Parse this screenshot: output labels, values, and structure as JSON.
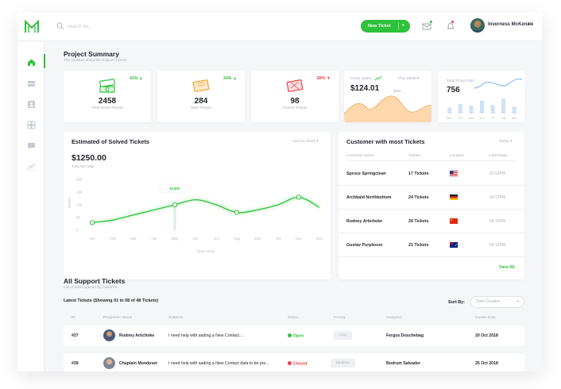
{
  "header": {
    "search_placeholder": "Search for...",
    "new_ticket_label": "New Ticket",
    "user_name": "Inverness McKenzie"
  },
  "colors": {
    "accent": "#2ec13a",
    "up": "#2ec13a",
    "down": "#f2424b",
    "orange": "#f0a436"
  },
  "sidebar": {
    "items": [
      {
        "icon": "home-icon",
        "active": true
      },
      {
        "icon": "ticket-stack-icon",
        "active": false
      },
      {
        "icon": "contact-card-icon",
        "active": false
      },
      {
        "icon": "grid-icon",
        "active": false
      },
      {
        "icon": "chat-icon",
        "active": false
      },
      {
        "icon": "stats-icon",
        "active": false
      }
    ]
  },
  "summary": {
    "title": "Project Summary",
    "subtitle": "The Updates about the Support Tickets",
    "stats": [
      {
        "pct": "41% ▲",
        "value": "2458",
        "label": "Total Novel Tickets",
        "icon": "ticket-stack-icon"
      },
      {
        "pct": "34% ▲",
        "value": "284",
        "label": "New Tickets",
        "icon": "ticket-icon"
      },
      {
        "pct": "68% ▼",
        "value": "98",
        "label": "Closed Tickets",
        "icon": "closed-ticket-icon"
      }
    ],
    "gross_sales": {
      "label": "Gross Sales",
      "value": "$124.01",
      "period": "This Week ▾",
      "peak_label": "$254"
    },
    "total_sold": {
      "label": "Total Ticket Sold",
      "value": "756",
      "days": [
        "Mon",
        "Tue",
        "Wed",
        "Thu",
        "Fri",
        "Sat",
        "Sun"
      ]
    }
  },
  "solved": {
    "title": "Estimated of Solved Tickets",
    "period": "Last 01 Years ▾",
    "amount": "$1250.00",
    "amount_label": "Total Net Sale",
    "tooltip": "$1000",
    "y_label": "Prices",
    "x_caption": "2018 Years"
  },
  "chart_data": {
    "type": "line",
    "title": "Estimated of Solved Tickets",
    "xlabel": "2018 Years",
    "ylabel": "Prices",
    "categories": [
      "Jan",
      "Feb",
      "Mar",
      "Apr",
      "May",
      "Jun",
      "Jul",
      "Aug",
      "Sep",
      "Oct",
      "Nov",
      "Dec"
    ],
    "values": [
      3,
      4,
      6,
      8,
      10,
      12,
      10,
      7,
      8,
      10,
      13,
      9
    ],
    "y_ticks": [
      "20k",
      "15k",
      "10k",
      "5k",
      "0"
    ],
    "ylim": [
      0,
      20
    ],
    "highlight_index": 4,
    "marked_indices": [
      0,
      4,
      7,
      10
    ]
  },
  "customers": {
    "title": "Customer with most Tickets",
    "period": "Today ▾",
    "headers": [
      "Customer Name",
      "Tickets",
      "Location",
      "Last Reply"
    ],
    "rows": [
      {
        "name": "Spruce Springclean",
        "tickets": "17 Tickets",
        "flag": "us-flag-icon",
        "time": "01:52PM"
      },
      {
        "name": "Archbald Northbottom",
        "tickets": "24 Tickets",
        "flag": "de-flag-icon",
        "time": "03:22PM"
      },
      {
        "name": "Rodney Artichoke",
        "tickets": "26 Tickets",
        "flag": "cn-flag-icon",
        "time": "04:10PM"
      },
      {
        "name": "Gustav Purpleson",
        "tickets": "21 Tickets",
        "flag": "au-flag-icon",
        "time": "06:12PM"
      }
    ],
    "view_all": "View All"
  },
  "tickets": {
    "title": "All Support Tickets",
    "subtitle": "List of ticket opened by Customer",
    "latest_label": "Latest Tickets (Showing 01 to 08 of 48 Tickets)",
    "sort_label": "Sort By:",
    "sort_value": "Date Created",
    "headers": [
      "ID",
      "Requester Name",
      "Subjects",
      "Status",
      "Priority",
      "Assignee",
      "Create Date"
    ],
    "rows": [
      {
        "id": "#27",
        "name": "Rodney Artichoke",
        "subject": "I need help with aading a New Contact....",
        "status": "Open",
        "priority": "Low",
        "assignee": "Fergus Douchebag",
        "date": "20 Oct 2018"
      },
      {
        "id": "#39",
        "name": "Chaplain Mondover",
        "subject": "I need help with aading a New Contact data to be pre...",
        "status": "Closed",
        "priority": "Medium",
        "assignee": "Bodrum Salvador",
        "date": "26 Oct 2018"
      }
    ]
  }
}
